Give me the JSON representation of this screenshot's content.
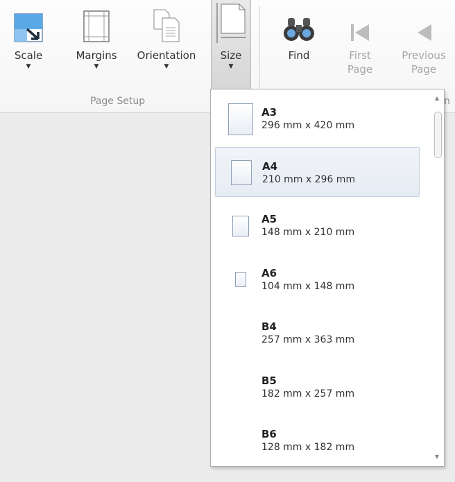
{
  "ribbon": {
    "buttons": [
      {
        "label": "Scale",
        "icon": "scale-icon",
        "dropdown": true
      },
      {
        "label": "Margins",
        "icon": "margins-icon",
        "dropdown": true
      },
      {
        "label": "Orientation",
        "icon": "orientation-icon",
        "dropdown": true
      },
      {
        "label": "Size",
        "icon": "page-size-icon",
        "dropdown": true,
        "active": true
      },
      {
        "label": "Find",
        "icon": "binoculars-icon"
      },
      {
        "label": "First Page",
        "line1": "First",
        "line2": "Page",
        "icon": "first-page-icon",
        "disabled": true
      },
      {
        "label": "Previous Page",
        "line1": "Previous",
        "line2": "Page",
        "icon": "previous-page-icon",
        "disabled": true
      }
    ],
    "group_label": "Page Setup",
    "next_group_label_partial": "n"
  },
  "size_menu": {
    "items": [
      {
        "name": "A3",
        "dims": "296 mm x 420 mm"
      },
      {
        "name": "A4",
        "dims": "210 mm x 296 mm",
        "selected": true
      },
      {
        "name": "A5",
        "dims": "148 mm x 210 mm"
      },
      {
        "name": "A6",
        "dims": "104 mm x 148 mm"
      },
      {
        "name": "B4",
        "dims": "257 mm x 363 mm"
      },
      {
        "name": "B5",
        "dims": "182 mm x 257 mm"
      },
      {
        "name": "B6",
        "dims": "128 mm x 182 mm"
      }
    ]
  },
  "colors": {
    "accent_icon": "#3a8fd6",
    "selected_item_bg": "#e6ecf4"
  }
}
